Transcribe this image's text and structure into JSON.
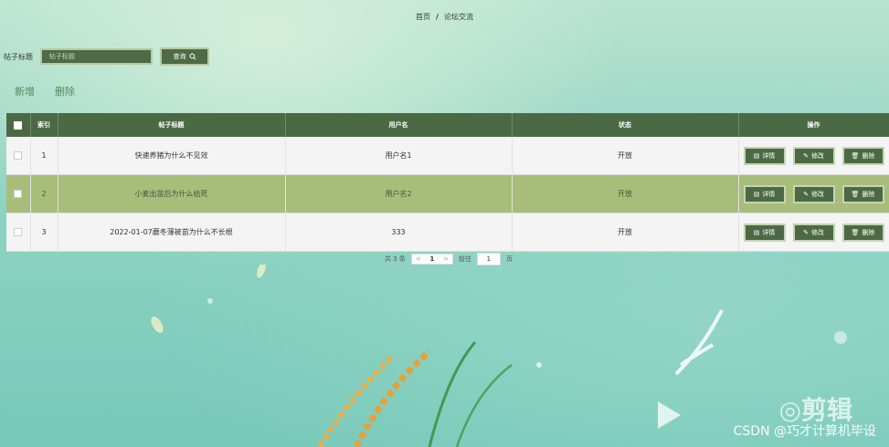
{
  "breadcrumb": {
    "home": "首页",
    "separator": "/",
    "current": "论坛交流"
  },
  "search": {
    "label": "帖子标题",
    "placeholder": "帖子标题",
    "value": "",
    "button": "查询"
  },
  "actions": {
    "add": "新增",
    "delete": "删除"
  },
  "table": {
    "headers": {
      "index": "索引",
      "title": "帖子标题",
      "username": "用户名",
      "status": "状态",
      "operation": "操作"
    },
    "rows": [
      {
        "index": "1",
        "title": "快速养猪为什么不见效",
        "username": "用户名1",
        "status": "开放"
      },
      {
        "index": "2",
        "title": "小麦出苗后为什么枯死",
        "username": "用户名2",
        "status": "开放"
      },
      {
        "index": "3",
        "title": "2022-01-07蘑冬薄被苗为什么不长根",
        "username": "333",
        "status": "开放"
      }
    ],
    "buttons": {
      "detail": "详情",
      "edit": "修改",
      "delete": "删除"
    }
  },
  "pagination": {
    "total": "共 3 条",
    "prev": "<",
    "current_page": "1",
    "next": ">",
    "goto": "前往",
    "goto_value": "1",
    "page_unit": "页"
  },
  "watermark": {
    "text": "CSDN @巧才计算机毕设",
    "logo": "◎剪辑"
  },
  "colors": {
    "primary": "#4b6a44",
    "highlight_row": "#a8bd7a",
    "link": "#4f8b62"
  },
  "icons": {
    "search": "search-icon",
    "detail": "document-icon",
    "edit": "pencil-icon",
    "delete": "trash-icon"
  }
}
